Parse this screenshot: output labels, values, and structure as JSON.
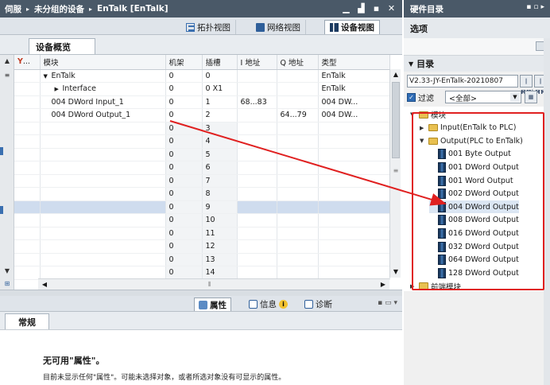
{
  "titlebar": {
    "breadcrumb": [
      "伺服",
      "未分组的设备",
      "EnTalk [EnTalk]"
    ],
    "arrow": "▸",
    "controls": [
      "▁",
      "▟",
      "▪",
      "✕"
    ]
  },
  "view_tabs": [
    {
      "label": "拓扑视图",
      "icon": "topology-icon",
      "active": false
    },
    {
      "label": "网络视图",
      "icon": "network-icon",
      "active": false
    },
    {
      "label": "设备视图",
      "icon": "device-icon",
      "active": true
    }
  ],
  "device_overview": {
    "tab_label": "设备概览",
    "columns": [
      "...",
      "模块",
      "机架",
      "插槽",
      "I 地址",
      "Q 地址",
      "类型"
    ],
    "rows": [
      {
        "module": "EnTalk",
        "tree": "▼",
        "rack": "0",
        "slot": "0",
        "i_addr": "",
        "q_addr": "",
        "type": "EnTalk"
      },
      {
        "module": "Interface",
        "tree": "▶",
        "rack": "0",
        "slot": "0 X1",
        "i_addr": "",
        "q_addr": "",
        "type": "EnTalk"
      },
      {
        "module": "004 DWord Input_1",
        "tree": "",
        "rack": "0",
        "slot": "1",
        "i_addr": "68...83",
        "q_addr": "",
        "type": "004 DW..."
      },
      {
        "module": "004 DWord Output_1",
        "tree": "",
        "rack": "0",
        "slot": "2",
        "i_addr": "",
        "q_addr": "64...79",
        "type": "004 DW..."
      },
      {
        "module": "",
        "tree": "",
        "rack": "0",
        "slot": "3",
        "i_addr": "",
        "q_addr": "",
        "type": ""
      },
      {
        "module": "",
        "tree": "",
        "rack": "0",
        "slot": "4",
        "i_addr": "",
        "q_addr": "",
        "type": ""
      },
      {
        "module": "",
        "tree": "",
        "rack": "0",
        "slot": "5",
        "i_addr": "",
        "q_addr": "",
        "type": ""
      },
      {
        "module": "",
        "tree": "",
        "rack": "0",
        "slot": "6",
        "i_addr": "",
        "q_addr": "",
        "type": ""
      },
      {
        "module": "",
        "tree": "",
        "rack": "0",
        "slot": "7",
        "i_addr": "",
        "q_addr": "",
        "type": ""
      },
      {
        "module": "",
        "tree": "",
        "rack": "0",
        "slot": "8",
        "i_addr": "",
        "q_addr": "",
        "type": ""
      },
      {
        "module": "",
        "tree": "",
        "rack": "0",
        "slot": "9",
        "i_addr": "",
        "q_addr": "",
        "type": ""
      },
      {
        "module": "",
        "tree": "",
        "rack": "0",
        "slot": "10",
        "i_addr": "",
        "q_addr": "",
        "type": ""
      },
      {
        "module": "",
        "tree": "",
        "rack": "0",
        "slot": "11",
        "i_addr": "",
        "q_addr": "",
        "type": ""
      },
      {
        "module": "",
        "tree": "",
        "rack": "0",
        "slot": "12",
        "i_addr": "",
        "q_addr": "",
        "type": ""
      },
      {
        "module": "",
        "tree": "",
        "rack": "0",
        "slot": "13",
        "i_addr": "",
        "q_addr": "",
        "type": ""
      },
      {
        "module": "",
        "tree": "",
        "rack": "0",
        "slot": "14",
        "i_addr": "",
        "q_addr": "",
        "type": ""
      }
    ],
    "selected_slot": "9"
  },
  "properties": {
    "tabs": [
      {
        "label": "属性",
        "icon": "properties-icon",
        "active": true
      },
      {
        "label": "信息",
        "icon": "info-icon",
        "active": false
      },
      {
        "label": "诊断",
        "icon": "diagnostics-icon",
        "active": false
      }
    ],
    "info_badge": "i",
    "general_tab": "常规",
    "title": "无可用\"属性\"。",
    "description": "目前未显示任何\"属性\"。可能未选择对象，或者所选对象没有可显示的属性。"
  },
  "hardware_catalog": {
    "title": "硬件目录",
    "options_label": "选项",
    "catalog_label": "目录",
    "search_value": "V2.33-JY-EnTalk-20210807",
    "search_btns": [
      "|ĦĦ|",
      "|ĦĦ"
    ],
    "filter_label": "过滤",
    "filter_checked": true,
    "profile_value": "<全部>",
    "tree": [
      {
        "label": "模块",
        "level": 0,
        "tri": "▼",
        "kind": "folder"
      },
      {
        "label": "Input(EnTalk to PLC)",
        "level": 1,
        "tri": "▶",
        "kind": "folder"
      },
      {
        "label": "Output(PLC to EnTalk)",
        "level": 1,
        "tri": "▼",
        "kind": "folder"
      },
      {
        "label": "001 Byte Output",
        "level": 2,
        "tri": "",
        "kind": "module"
      },
      {
        "label": "001 DWord Output",
        "level": 2,
        "tri": "",
        "kind": "module"
      },
      {
        "label": "001 Word Output",
        "level": 2,
        "tri": "",
        "kind": "module"
      },
      {
        "label": "002 DWord Output",
        "level": 2,
        "tri": "",
        "kind": "module"
      },
      {
        "label": "004 DWord Output",
        "level": 2,
        "tri": "",
        "kind": "module",
        "highlight": true
      },
      {
        "label": "008 DWord Output",
        "level": 2,
        "tri": "",
        "kind": "module"
      },
      {
        "label": "016 DWord Output",
        "level": 2,
        "tri": "",
        "kind": "module"
      },
      {
        "label": "032 DWord Output",
        "level": 2,
        "tri": "",
        "kind": "module"
      },
      {
        "label": "064 DWord Output",
        "level": 2,
        "tri": "",
        "kind": "module"
      },
      {
        "label": "128 DWord Output",
        "level": 2,
        "tri": "",
        "kind": "module"
      },
      {
        "label": "前端模块",
        "level": 0,
        "tri": "▶",
        "kind": "folder"
      }
    ]
  },
  "colors": {
    "title_bar": "#4a5968",
    "annotation_red": "#e02020",
    "selection": "#cfdcee"
  }
}
